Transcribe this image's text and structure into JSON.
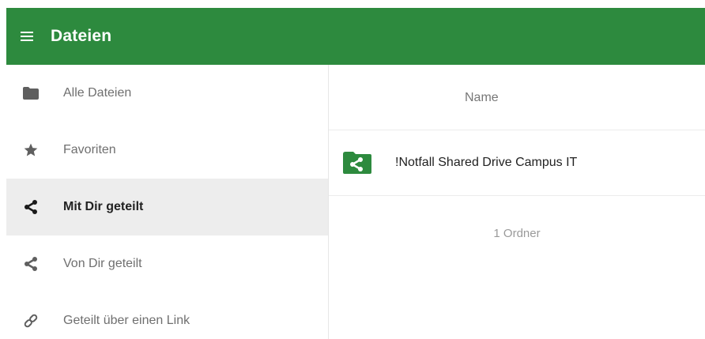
{
  "header": {
    "title": "Dateien",
    "menu_icon": "hamburger-menu-icon",
    "background_color": "#2d8a3e"
  },
  "sidebar": {
    "items": [
      {
        "label": "Alle Dateien",
        "icon": "folder-icon",
        "active": false
      },
      {
        "label": "Favoriten",
        "icon": "star-icon",
        "active": false
      },
      {
        "label": "Mit Dir geteilt",
        "icon": "share-icon",
        "active": true
      },
      {
        "label": "Von Dir geteilt",
        "icon": "share-icon",
        "active": false
      },
      {
        "label": "Geteilt über einen Link",
        "icon": "link-icon",
        "active": false
      }
    ]
  },
  "file_list": {
    "column_name": "Name",
    "rows": [
      {
        "name": "!Notfall Shared Drive Campus IT",
        "icon": "shared-folder-icon",
        "icon_color": "#2d8a3e"
      }
    ],
    "summary": "1 Ordner"
  }
}
